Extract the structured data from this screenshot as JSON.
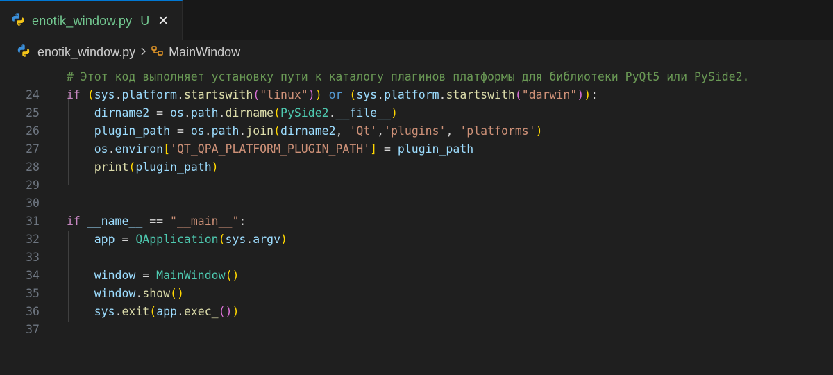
{
  "tab": {
    "filename": "enotik_window.py",
    "status": "U",
    "close_glyph": "✕",
    "icon": "python-icon"
  },
  "breadcrumb": {
    "file": "enotik_window.py",
    "separator_icon": "chevron-right-icon",
    "class_icon": "class-symbol-icon",
    "class_name": "MainWindow"
  },
  "editor": {
    "line_numbers": [
      "24",
      "25",
      "26",
      "27",
      "28",
      "29",
      "30",
      "31",
      "32",
      "33",
      "34",
      "35",
      "36",
      "37"
    ],
    "lines": {
      "l24": {
        "comment": "# Этот код выполняет установку пути к каталогу плагинов платформы для библиотеки PyQt5 или PySide2."
      },
      "l25": {
        "t1": "if",
        "t2": " ",
        "t3": "(",
        "t4": "sys",
        "t5": ".",
        "t6": "platform",
        "t7": ".",
        "t8": "startswith",
        "t9": "(",
        "t10": "\"linux\"",
        "t11": ")",
        "t12": ")",
        "t13": " ",
        "t14": "or",
        "t15": " ",
        "t16": "(",
        "t17": "sys",
        "t18": ".",
        "t19": "platform",
        "t20": ".",
        "t21": "startswith",
        "t22": "(",
        "t23": "\"darwin\"",
        "t24": ")",
        "t25": ")",
        "t26": ":"
      },
      "l26": {
        "t1": "    ",
        "t2": "dirname2",
        "t3": " = ",
        "t4": "os",
        "t5": ".",
        "t6": "path",
        "t7": ".",
        "t8": "dirname",
        "t9": "(",
        "t10": "PySide2",
        "t11": ".",
        "t12": "__file__",
        "t13": ")"
      },
      "l27": {
        "t1": "    ",
        "t2": "plugin_path",
        "t3": " = ",
        "t4": "os",
        "t5": ".",
        "t6": "path",
        "t7": ".",
        "t8": "join",
        "t9": "(",
        "t10": "dirname2",
        "t11": ", ",
        "t12": "'Qt'",
        "t13": ",",
        "t14": "'plugins'",
        "t15": ", ",
        "t16": "'platforms'",
        "t17": ")"
      },
      "l28": {
        "t1": "    ",
        "t2": "os",
        "t3": ".",
        "t4": "environ",
        "t5": "[",
        "t6": "'QT_QPA_PLATFORM_PLUGIN_PATH'",
        "t7": "]",
        "t8": " = ",
        "t9": "plugin_path"
      },
      "l29": {
        "t1": "    ",
        "t2": "print",
        "t3": "(",
        "t4": "plugin_path",
        "t5": ")"
      },
      "l32": {
        "t1": "if",
        "t2": " ",
        "t3": "__name__",
        "t4": " == ",
        "t5": "\"__main__\"",
        "t6": ":"
      },
      "l33": {
        "t1": "    ",
        "t2": "app",
        "t3": " = ",
        "t4": "QApplication",
        "t5": "(",
        "t6": "sys",
        "t7": ".",
        "t8": "argv",
        "t9": ")"
      },
      "l35": {
        "t1": "    ",
        "t2": "window",
        "t3": " = ",
        "t4": "MainWindow",
        "t5": "()"
      },
      "l36": {
        "t1": "    ",
        "t2": "window",
        "t3": ".",
        "t4": "show",
        "t5": "()"
      },
      "l37": {
        "t1": "    ",
        "t2": "sys",
        "t3": ".",
        "t4": "exit",
        "t5": "(",
        "t6": "app",
        "t7": ".",
        "t8": "exec_",
        "t9": "(",
        "t10": ")",
        "t11": ")"
      }
    }
  },
  "colors": {
    "background": "#1f1f1f",
    "tab_accent": "#0078d4",
    "modified_text": "#73c991",
    "comment": "#6a9955",
    "keyword": "#c586c0",
    "string": "#ce9178",
    "function": "#dcdcaa",
    "variable": "#9cdcfe",
    "class": "#4ec9b0"
  }
}
